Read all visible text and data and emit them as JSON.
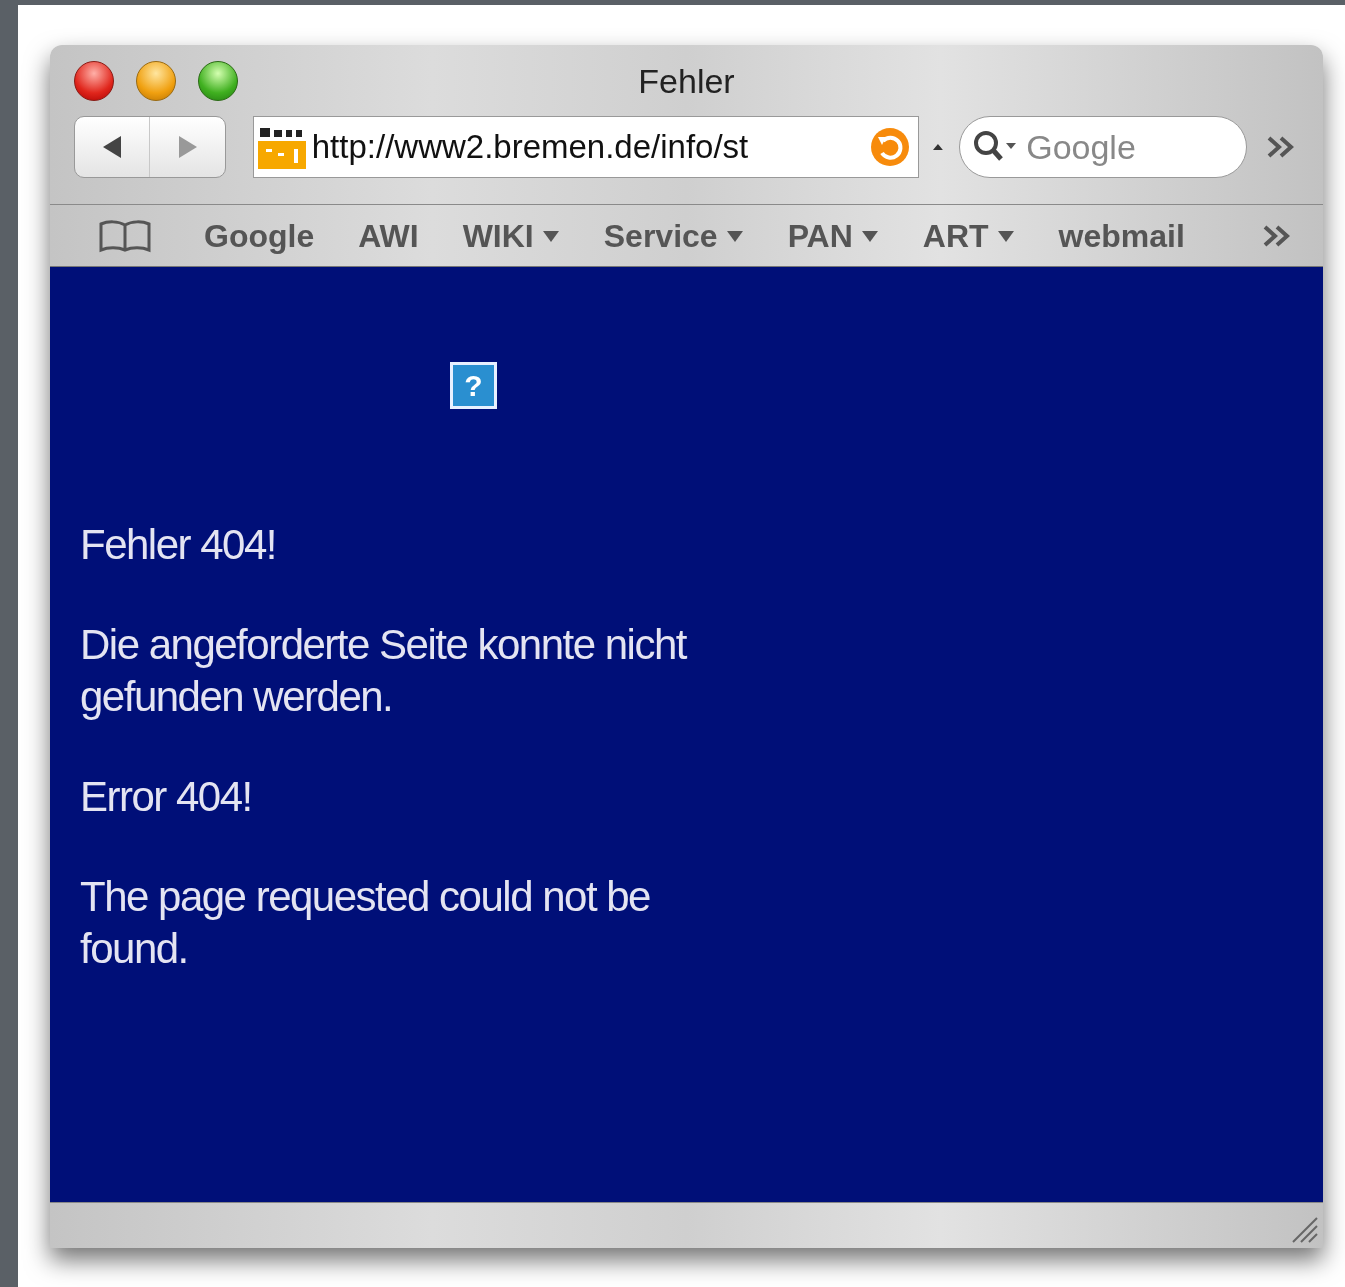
{
  "window": {
    "title": "Fehler"
  },
  "toolbar": {
    "address": "http://www2.bremen.de/info/st",
    "search": {
      "placeholder": "Google"
    }
  },
  "bookmarks": [
    {
      "label": "Google",
      "menu": false
    },
    {
      "label": "AWI",
      "menu": false
    },
    {
      "label": "WIKI",
      "menu": true
    },
    {
      "label": "Service",
      "menu": true
    },
    {
      "label": "PAN",
      "menu": true
    },
    {
      "label": "ART",
      "menu": true
    },
    {
      "label": "webmail",
      "menu": false
    }
  ],
  "page": {
    "broken_image": "?",
    "paragraphs": [
      "Fehler 404!",
      "Die angeforderte Seite konnte nicht gefunden werden.",
      "Error 404!",
      "The page requested could not be found."
    ]
  }
}
